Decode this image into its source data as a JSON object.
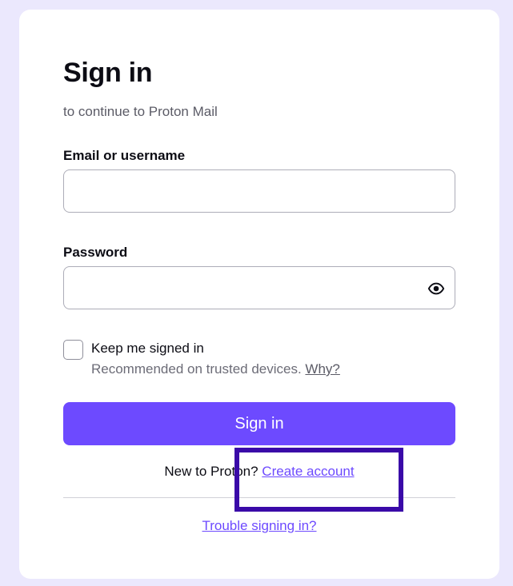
{
  "signin": {
    "title": "Sign in",
    "subtitle": "to continue to Proton Mail",
    "email_label": "Email or username",
    "email_value": "",
    "password_label": "Password",
    "password_value": "",
    "keep_signed_in_label": "Keep me signed in",
    "recommended_text": "Recommended on trusted devices. ",
    "why_link": "Why?",
    "signin_button": "Sign in",
    "new_to_text": "New to Proton? ",
    "create_account_link": "Create account",
    "trouble_link": "Trouble signing in?"
  },
  "colors": {
    "accent": "#6d4aff",
    "background": "#ebe8fd",
    "highlight_box": "#3a0aa8"
  },
  "icons": {
    "password_toggle": "eye-icon"
  }
}
